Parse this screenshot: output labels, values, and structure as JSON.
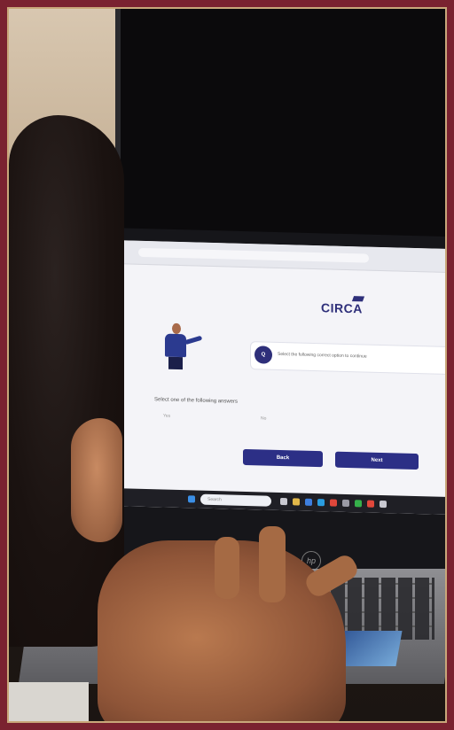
{
  "scene": {
    "description_type": "photo_of_laptop_screen"
  },
  "screen": {
    "logo_text": "CIRCA",
    "question_badge": "Q",
    "question_text": "Select the following correct option to continue",
    "prompt_text": "Select one of the following answers",
    "options": [
      "Yes",
      "No"
    ],
    "buttons": {
      "back_label": "Back",
      "next_label": "Next"
    },
    "taskbar": {
      "search_placeholder": "Search"
    }
  },
  "colors": {
    "frame": "#7a2230",
    "accent": "#2c2f86",
    "screen_bg": "#f4f4f8"
  },
  "icons": {
    "taskbar": [
      "windows-icon",
      "browser-icon",
      "folder-icon",
      "store-icon",
      "mail-icon",
      "chrome-icon"
    ],
    "laptop": "hp-logo-icon"
  }
}
